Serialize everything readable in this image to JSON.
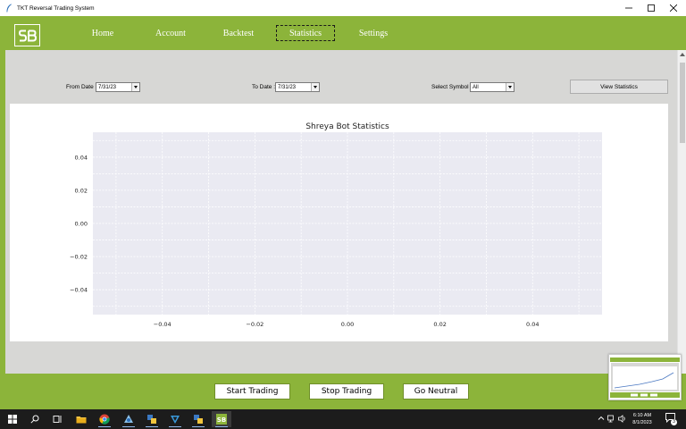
{
  "window": {
    "title": "TKT Reversal Trading System"
  },
  "nav": {
    "logo_text": "SB",
    "items": [
      {
        "label": "Home"
      },
      {
        "label": "Account"
      },
      {
        "label": "Backtest"
      },
      {
        "label": "Statistics",
        "active": true
      },
      {
        "label": "Settings"
      }
    ]
  },
  "filters": {
    "from_label": "From Date :",
    "from_value": "7/31/23",
    "to_label": "To Date :",
    "to_value": "7/31/23",
    "symbol_label": "Select Symbol :",
    "symbol_value": "All",
    "view_button": "View Statistics"
  },
  "chart_data": {
    "type": "scatter",
    "title": "Shreya Bot Statistics",
    "xlabel": "",
    "ylabel": "",
    "xlim": [
      -0.055,
      0.055
    ],
    "ylim": [
      -0.055,
      0.055
    ],
    "x_ticks": [
      -0.04,
      -0.02,
      0.0,
      0.02,
      0.04
    ],
    "y_ticks": [
      0.04,
      0.02,
      0.0,
      -0.02,
      -0.04
    ],
    "x_tick_labels": [
      "−0.04",
      "−0.02",
      "0.00",
      "0.02",
      "0.04"
    ],
    "y_tick_labels": [
      "0.04",
      "0.02",
      "0.00",
      "−0.02",
      "−0.04"
    ],
    "grid": true,
    "background": "#eaeaf2",
    "series": []
  },
  "actions": {
    "start": "Start Trading",
    "stop": "Stop Trading",
    "neutral": "Go Neutral"
  },
  "taskbar": {
    "time": "6:10 AM",
    "date": "8/1/2023",
    "notification_count": "3"
  },
  "colors": {
    "accent": "#8cb43a",
    "panel": "#d7d7d5",
    "plot_bg": "#eaeaf2"
  }
}
